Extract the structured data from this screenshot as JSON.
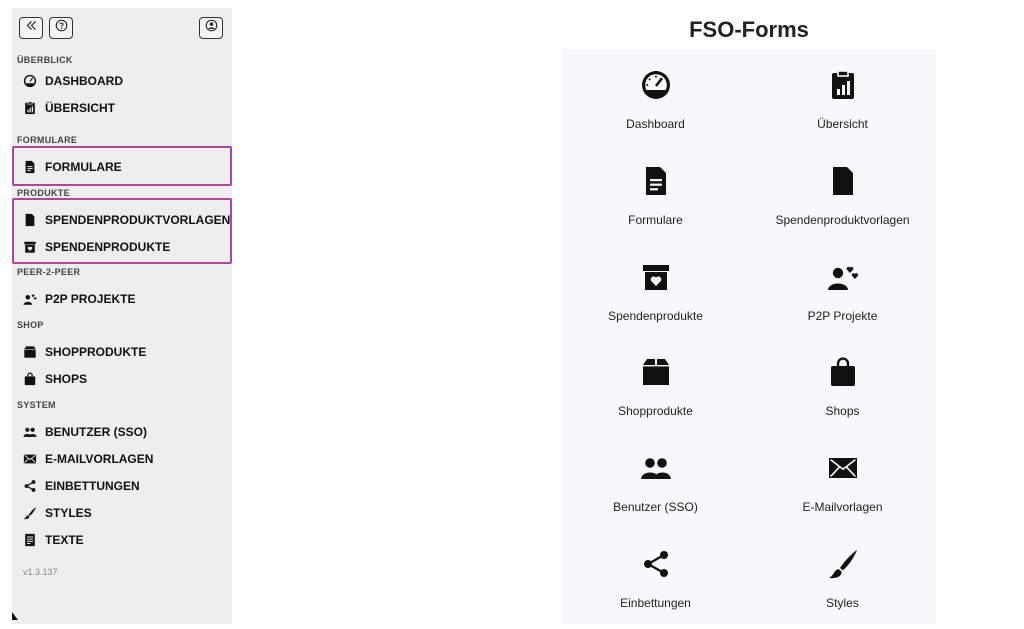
{
  "app": {
    "title": "FSO-Forms",
    "version": "v1.3.137"
  },
  "topbar": {
    "collapse_icon": "double-chevron-left-icon",
    "help_icon": "question-circle-icon",
    "user_icon": "user-circle-icon"
  },
  "sidebar": {
    "sections": [
      {
        "title": "ÜBERBLICK",
        "items": [
          {
            "label": "DASHBOARD",
            "icon": "gauge-icon"
          },
          {
            "label": "ÜBERSICHT",
            "icon": "clipboard-chart-icon"
          }
        ]
      },
      {
        "title": "FORMULARE",
        "items": [
          {
            "label": "FORMULARE",
            "icon": "document-lines-icon"
          }
        ]
      },
      {
        "title": "PRODUKTE",
        "items": [
          {
            "label": "SPENDENPRODUKTVORLAGEN",
            "icon": "document-icon"
          },
          {
            "label": "SPENDENPRODUKTE",
            "icon": "box-heart-icon"
          }
        ]
      },
      {
        "title": "PEER-2-PEER",
        "items": [
          {
            "label": "P2P PROJEKTE",
            "icon": "user-hearts-icon"
          }
        ]
      },
      {
        "title": "SHOP",
        "items": [
          {
            "label": "SHOPPRODUKTE",
            "icon": "box-icon"
          },
          {
            "label": "SHOPS",
            "icon": "shopping-bag-icon"
          }
        ]
      },
      {
        "title": "SYSTEM",
        "items": [
          {
            "label": "BENUTZER (SSO)",
            "icon": "users-icon"
          },
          {
            "label": "E-MAILVORLAGEN",
            "icon": "envelope-icon"
          },
          {
            "label": "EINBETTUNGEN",
            "icon": "share-icon"
          },
          {
            "label": "STYLES",
            "icon": "brush-icon"
          },
          {
            "label": "TEXTE",
            "icon": "text-document-icon"
          }
        ]
      }
    ]
  },
  "tiles": [
    {
      "label": "Dashboard",
      "icon": "gauge-icon"
    },
    {
      "label": "Übersicht",
      "icon": "clipboard-chart-icon"
    },
    {
      "label": "Formulare",
      "icon": "document-lines-icon"
    },
    {
      "label": "Spendenproduktvorlagen",
      "icon": "document-icon"
    },
    {
      "label": "Spendenprodukte",
      "icon": "box-heart-icon"
    },
    {
      "label": "P2P Projekte",
      "icon": "user-hearts-icon"
    },
    {
      "label": "Shopprodukte",
      "icon": "box-icon"
    },
    {
      "label": "Shops",
      "icon": "shopping-bag-icon"
    },
    {
      "label": "Benutzer (SSO)",
      "icon": "users-icon"
    },
    {
      "label": "E-Mailvorlagen",
      "icon": "envelope-icon"
    },
    {
      "label": "Einbettungen",
      "icon": "share-icon"
    },
    {
      "label": "Styles",
      "icon": "brush-icon"
    }
  ],
  "colors": {
    "highlight": "#b0459b",
    "sidebar_bg": "#eeeeee",
    "grid_bg": "#f7f8f9"
  }
}
